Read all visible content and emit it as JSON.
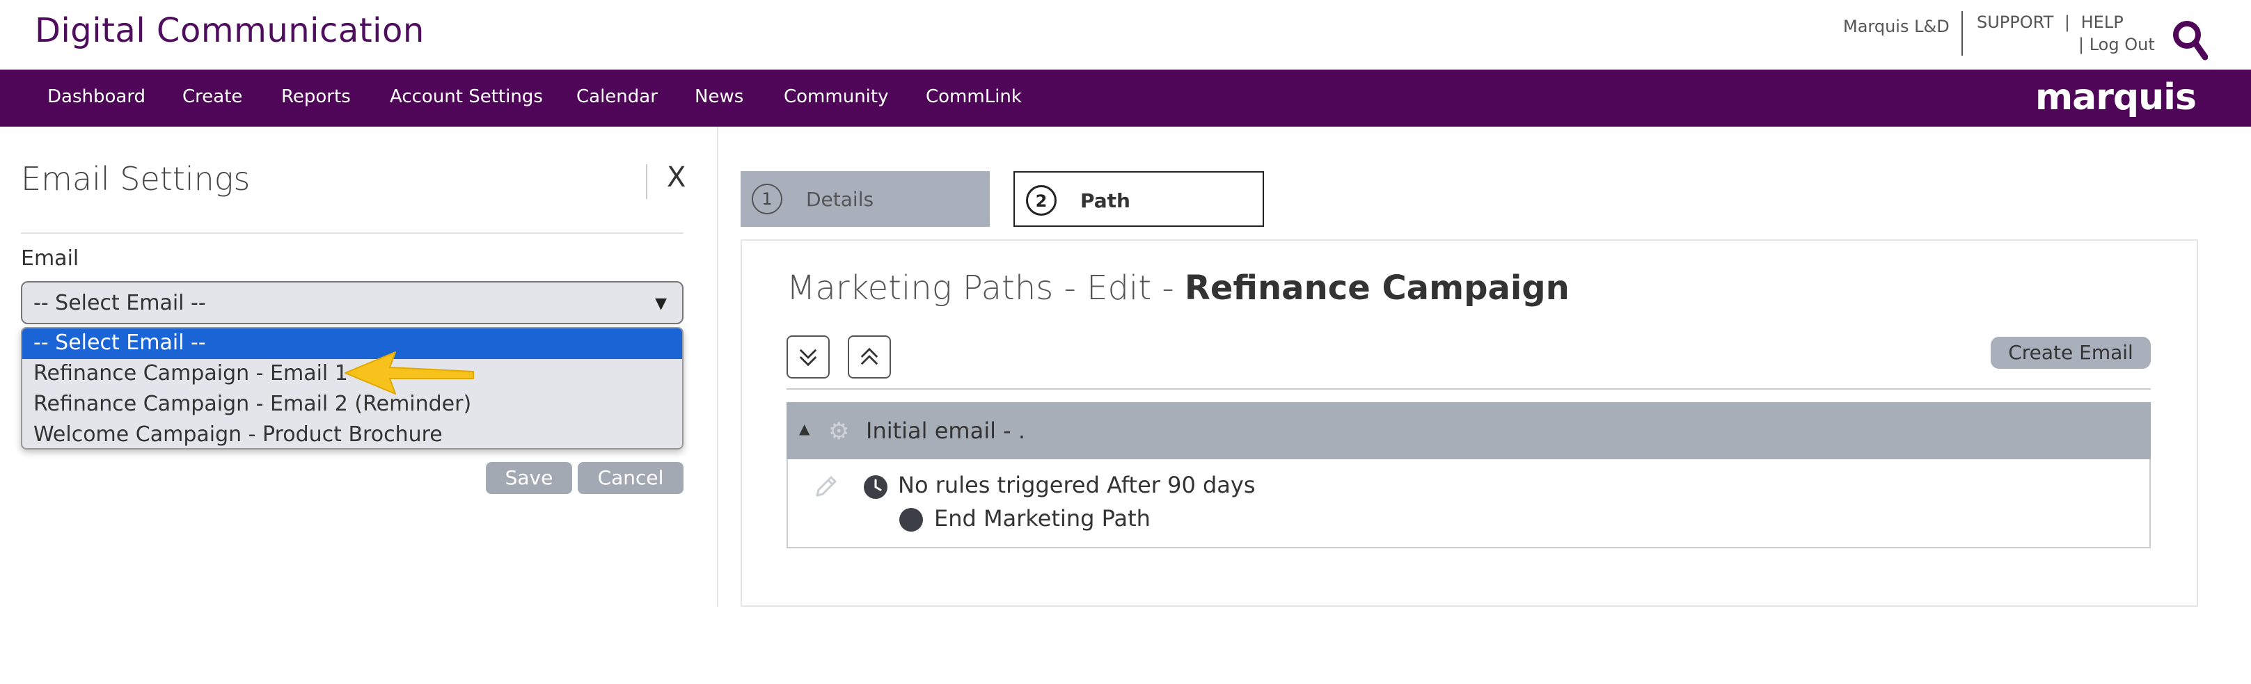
{
  "header": {
    "app_title": "Digital Communication",
    "account_name": "Marquis L&D",
    "support": "SUPPORT",
    "pipe": "|",
    "help": "HELP",
    "logout": "| Log Out",
    "search_icon": "search-icon"
  },
  "nav": {
    "items": [
      {
        "label": "Dashboard"
      },
      {
        "label": "Create"
      },
      {
        "label": "Reports"
      },
      {
        "label": "Account Settings"
      },
      {
        "label": "Calendar"
      },
      {
        "label": "News"
      },
      {
        "label": "Community"
      },
      {
        "label": "CommLink"
      }
    ],
    "brand": "marquis",
    "bar_color": "#4f0659"
  },
  "email_settings": {
    "title": "Email Settings",
    "close_label": "X",
    "email_label": "Email",
    "selected_value": "-- Select Email --",
    "options": [
      {
        "label": "-- Select Email --",
        "selected": true
      },
      {
        "label": "Refinance Campaign - Email 1"
      },
      {
        "label": "Refinance Campaign - Email 2 (Reminder)"
      },
      {
        "label": "Welcome Campaign - Product Brochure"
      }
    ],
    "save_label": "Save",
    "cancel_label": "Cancel",
    "highlight_color": "#1b64d6",
    "annotation_arrow_color": "#f7c21b"
  },
  "steps": [
    {
      "number": "1",
      "label": "Details",
      "active": false
    },
    {
      "number": "2",
      "label": "Path",
      "active": true
    }
  ],
  "marketing_path": {
    "title_prefix": "Marketing Paths - Edit - ",
    "title_name": "Refinance Campaign",
    "create_email_label": "Create Email",
    "expand_icon": "chevrons-down-icon",
    "collapse_icon": "chevrons-up-icon",
    "node": {
      "header": "Initial email - .",
      "rule": "No rules triggered After 90 days",
      "end": "End Marketing Path"
    }
  }
}
